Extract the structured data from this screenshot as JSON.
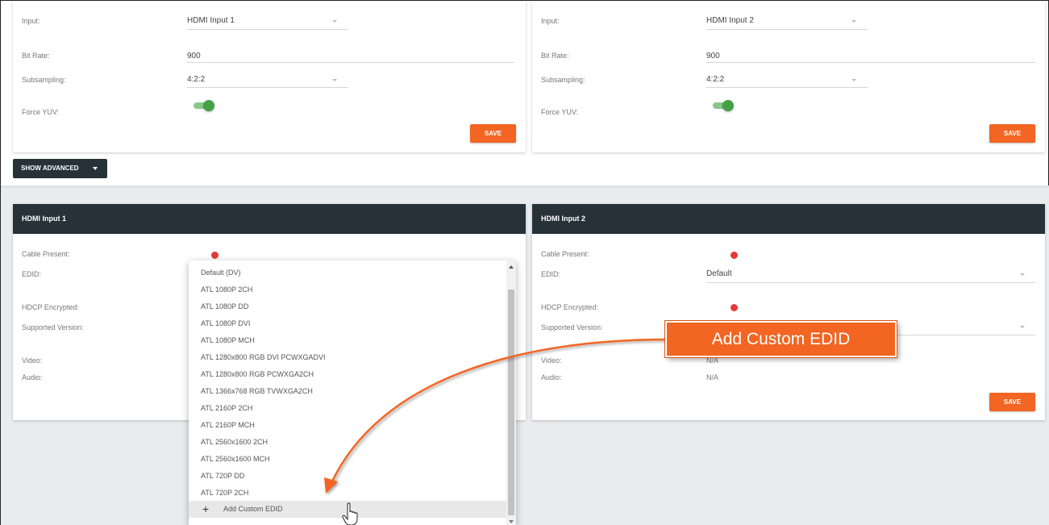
{
  "top_left": {
    "input_label": "Input:",
    "input_value": "HDMI Input 1",
    "bitrate_label": "Bit Rate:",
    "bitrate_value": "900",
    "subsampling_label": "Subsampling:",
    "subsampling_value": "4:2:2",
    "force_yuv_label": "Force YUV:",
    "save_label": "SAVE"
  },
  "top_right": {
    "input_label": "Input:",
    "input_value": "HDMI Input 2",
    "bitrate_label": "Bit Rate:",
    "bitrate_value": "900",
    "subsampling_label": "Subsampling:",
    "subsampling_value": "4:2:2",
    "force_yuv_label": "Force YUV:",
    "save_label": "SAVE"
  },
  "show_advanced_label": "SHOW ADVANCED",
  "hdmi1": {
    "title": "HDMI Input 1",
    "cable_present_label": "Cable Present:",
    "edid_label": "EDID:",
    "hdcp_label": "HDCP Encrypted:",
    "supported_version_label": "Supported Version:",
    "video_label": "Video:",
    "audio_label": "Audio:"
  },
  "hdmi2": {
    "title": "HDMI Input 2",
    "cable_present_label": "Cable Present:",
    "edid_label": "EDID:",
    "edid_value": "Default",
    "hdcp_label": "HDCP Encrypted:",
    "supported_version_label": "Supported Version:",
    "video_label": "Video:",
    "video_value": "N/A",
    "audio_label": "Audio:",
    "audio_value": "N/A",
    "save_label": "SAVE"
  },
  "edid_dropdown": {
    "options": [
      "Default (DV)",
      "ATL 1080P 2CH",
      "ATL 1080P DD",
      "ATL 1080P DVI",
      "ATL 1080P MCH",
      "ATL 1280x800 RGB DVI PCWXGADVI",
      "ATL 1280x800 RGB PCWXGA2CH",
      "ATL 1366x768 RGB TVWXGA2CH",
      "ATL 2160P 2CH",
      "ATL 2160P MCH",
      "ATL 2560x1600 2CH",
      "ATL 2560x1600 MCH",
      "ATL 720P DD",
      "ATL 720P 2CH"
    ],
    "add_custom_label": "Add Custom EDID"
  },
  "callout_text": "Add Custom EDID",
  "colors": {
    "accent": "#f26522",
    "header": "#263238",
    "toggle_on": "#43a047",
    "status_red": "#e53935"
  },
  "icons": [
    "chevron-down-icon",
    "plus-icon",
    "hand-cursor-icon",
    "red-status-dot"
  ]
}
